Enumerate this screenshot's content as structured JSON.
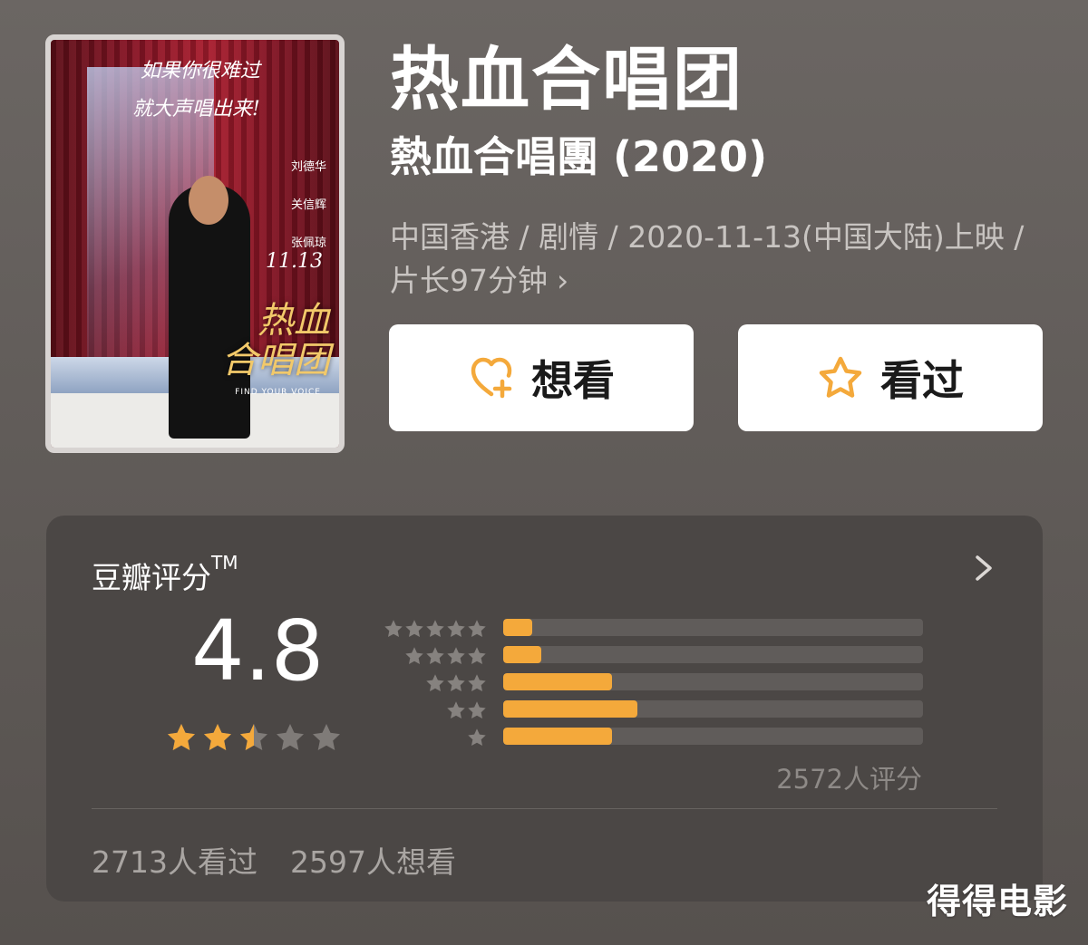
{
  "poster": {
    "tagline_1": "如果你很难过",
    "tagline_2": "就大声唱出来!",
    "cast": [
      "刘德华",
      "关信辉",
      "张佩琼"
    ],
    "date": "11.13",
    "logo_1": "热血",
    "logo_2": "合唱团",
    "subtitle_en": "FIND YOUR VOICE"
  },
  "movie": {
    "title_cn": "热血合唱团",
    "title_tw": "熱血合唱團 (2020)",
    "meta": "中国香港 / 剧情 / 2020-11-13(中国大陆)上映 / 片长97分钟"
  },
  "actions": {
    "want_label": "想看",
    "seen_label": "看过",
    "accent": "#f4a93b"
  },
  "rating": {
    "title": "豆瓣评分",
    "tm": "TM",
    "score": "4.8",
    "stars_filled": 2.5,
    "stars_max": 5,
    "distribution": [
      {
        "stars": 5,
        "fraction": 0.07
      },
      {
        "stars": 4,
        "fraction": 0.09
      },
      {
        "stars": 3,
        "fraction": 0.26
      },
      {
        "stars": 2,
        "fraction": 0.32
      },
      {
        "stars": 1,
        "fraction": 0.26
      }
    ],
    "raters": "2572人评分",
    "seen_count": "2713人看过",
    "want_count": "2597人想看"
  },
  "watermark": "得得电影",
  "colors": {
    "background": "#67625f",
    "card": "#4b4745",
    "bar_fill": "#f4a93b",
    "bar_track": "#605c5a",
    "star_on": "#f4a93b",
    "star_off": "#7f7b78"
  }
}
